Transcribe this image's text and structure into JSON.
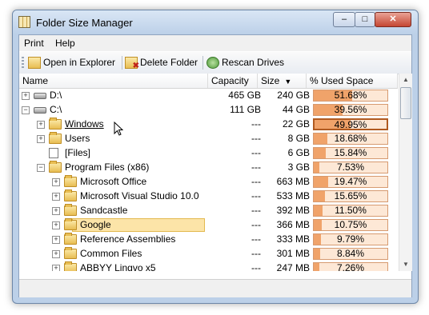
{
  "window": {
    "title": "Folder Size Manager"
  },
  "menu": [
    "Print",
    "Help"
  ],
  "toolbar": {
    "open_explorer": "Open in Explorer",
    "delete_folder": "Delete Folder",
    "rescan_drives": "Rescan Drives"
  },
  "columns": {
    "name": "Name",
    "capacity": "Capacity",
    "size": "Size",
    "size_sort": "▼",
    "used": "% Used Space"
  },
  "rows": [
    {
      "indent": 0,
      "expander": "+",
      "icon": "drive-icon",
      "name": "D:\\",
      "capacity": "465 GB",
      "size": "240 GB",
      "pct": "51.68%",
      "fill": 0.5168
    },
    {
      "indent": 0,
      "expander": "−",
      "icon": "drive-icon",
      "name": "C:\\",
      "capacity": "111 GB",
      "size": "44 GB",
      "pct": "39.56%",
      "fill": 0.3956
    },
    {
      "indent": 1,
      "expander": "+",
      "icon": "folder-icon",
      "name": "Windows",
      "capacity": "---",
      "size": "22 GB",
      "pct": "49.95%",
      "fill": 0.4995,
      "link": true,
      "highlight": true
    },
    {
      "indent": 1,
      "expander": "+",
      "icon": "folder-icon",
      "name": "Users",
      "capacity": "---",
      "size": "8 GB",
      "pct": "18.68%",
      "fill": 0.1868
    },
    {
      "indent": 1,
      "expander": "",
      "icon": "file-icon",
      "name": "[Files]",
      "capacity": "---",
      "size": "6 GB",
      "pct": "15.84%",
      "fill": 0.1584
    },
    {
      "indent": 1,
      "expander": "−",
      "icon": "folder-icon",
      "name": "Program Files (x86)",
      "capacity": "---",
      "size": "3 GB",
      "pct": "7.53%",
      "fill": 0.0753
    },
    {
      "indent": 2,
      "expander": "+",
      "icon": "folder-icon",
      "name": "Microsoft Office",
      "capacity": "---",
      "size": "663 MB",
      "pct": "19.47%",
      "fill": 0.1947
    },
    {
      "indent": 2,
      "expander": "+",
      "icon": "folder-icon",
      "name": "Microsoft Visual Studio 10.0",
      "capacity": "---",
      "size": "533 MB",
      "pct": "15.65%",
      "fill": 0.1565
    },
    {
      "indent": 2,
      "expander": "+",
      "icon": "folder-icon",
      "name": "Sandcastle",
      "capacity": "---",
      "size": "392 MB",
      "pct": "11.50%",
      "fill": 0.115
    },
    {
      "indent": 2,
      "expander": "+",
      "icon": "folder-icon",
      "name": "Google",
      "capacity": "---",
      "size": "366 MB",
      "pct": "10.75%",
      "fill": 0.1075,
      "selected": true
    },
    {
      "indent": 2,
      "expander": "+",
      "icon": "folder-icon",
      "name": "Reference Assemblies",
      "capacity": "---",
      "size": "333 MB",
      "pct": "9.79%",
      "fill": 0.0979
    },
    {
      "indent": 2,
      "expander": "+",
      "icon": "folder-icon",
      "name": "Common Files",
      "capacity": "---",
      "size": "301 MB",
      "pct": "8.84%",
      "fill": 0.0884
    },
    {
      "indent": 2,
      "expander": "+",
      "icon": "folder-icon",
      "name": "ABBYY Lingvo x5",
      "capacity": "---",
      "size": "247 MB",
      "pct": "7.26%",
      "fill": 0.0726
    }
  ],
  "colors": {
    "bar_fill": "#f0a36a",
    "bar_bg": "#fde8d6",
    "selected_bg": "#fce4a8"
  }
}
